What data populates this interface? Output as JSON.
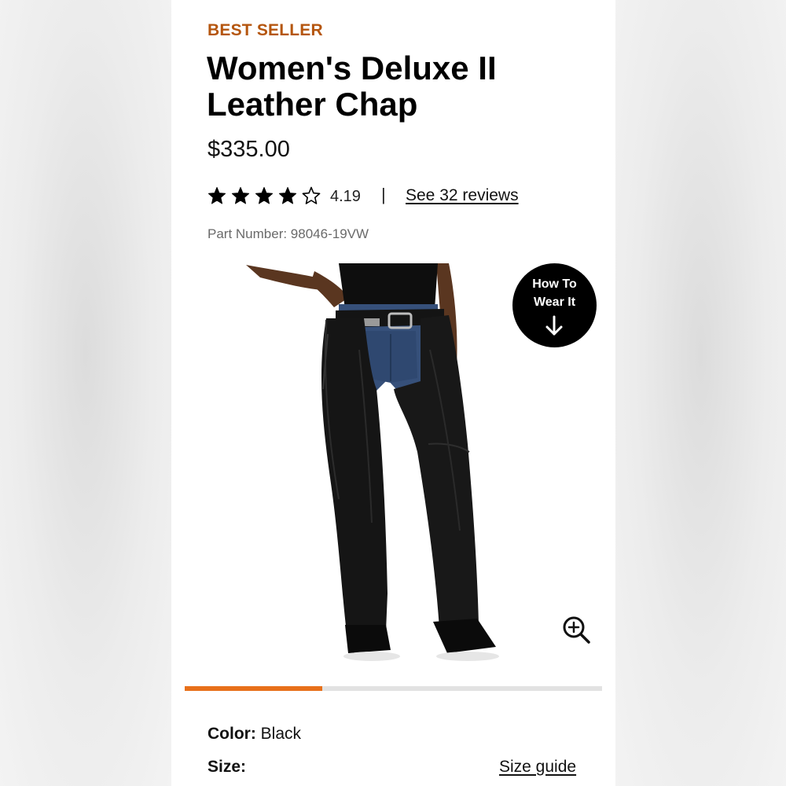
{
  "product": {
    "badge": "BEST SELLER",
    "title": "Women's Deluxe II Leather Chap",
    "price": "$335.00",
    "rating": {
      "value": "4.19",
      "stars_filled": 4,
      "stars_total": 5,
      "separator": "|",
      "reviews_link": "See 32 reviews"
    },
    "part_number": "Part Number: 98046-19VW"
  },
  "gallery": {
    "image_subject": "black leather chaps over blue jeans with black boots",
    "how_to_wear": {
      "line1": "How To",
      "line2": "Wear It"
    },
    "zoom_icon": "zoom-in-icon",
    "progress": 0.33,
    "progress_color": "#e8701a"
  },
  "options": {
    "color_label": "Color:",
    "color_value": "Black",
    "size_label": "Size:",
    "size_guide": "Size guide"
  },
  "colors": {
    "badge": "#b5560f",
    "accent": "#e8701a"
  }
}
